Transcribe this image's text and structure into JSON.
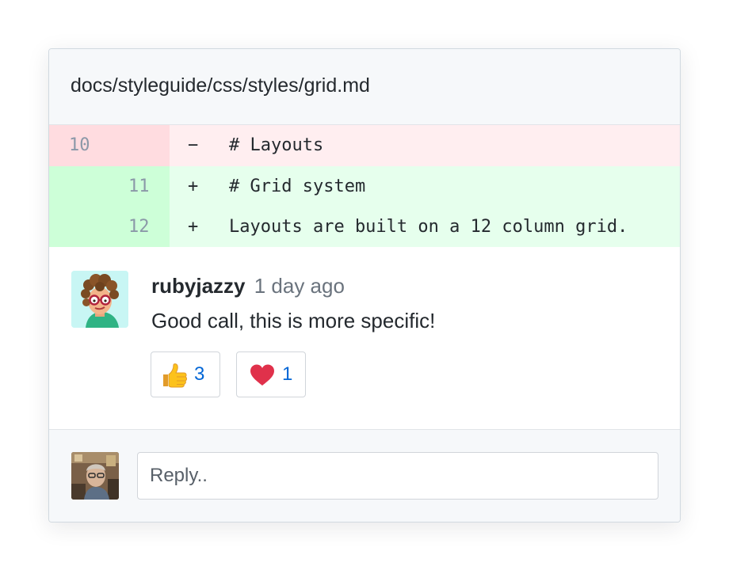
{
  "file": {
    "path": "docs/styleguide/css/styles/grid.md"
  },
  "diff": {
    "lines": [
      {
        "type": "deletion",
        "old_num": "10",
        "new_num": "",
        "marker": "−",
        "code": "# Layouts"
      },
      {
        "type": "addition",
        "old_num": "",
        "new_num": "11",
        "marker": "+",
        "code": "# Grid system"
      },
      {
        "type": "addition",
        "old_num": "",
        "new_num": "12",
        "marker": "+",
        "code": "Layouts are built on a 12 column grid."
      }
    ],
    "colors": {
      "deletion_bg": "#ffeef0",
      "deletion_gutter": "#ffdce0",
      "addition_bg": "#e6ffed",
      "addition_gutter": "#cdffd8"
    }
  },
  "comment": {
    "author": "rubyjazzy",
    "timestamp": "1 day ago",
    "body": "Good call, this is more specific!",
    "avatar_icon": "cartoon-avatar-curly-hair-glasses",
    "reactions": [
      {
        "icon": "thumbs-up-icon",
        "count": "3"
      },
      {
        "icon": "heart-icon",
        "count": "1"
      }
    ]
  },
  "reply": {
    "placeholder": "Reply..",
    "value": "",
    "avatar_icon": "user-photo-avatar"
  },
  "colors": {
    "link_blue": "#0366d6",
    "muted_text": "#6a737d",
    "heart_red": "#e0314b",
    "header_bg": "#f6f8fa"
  }
}
